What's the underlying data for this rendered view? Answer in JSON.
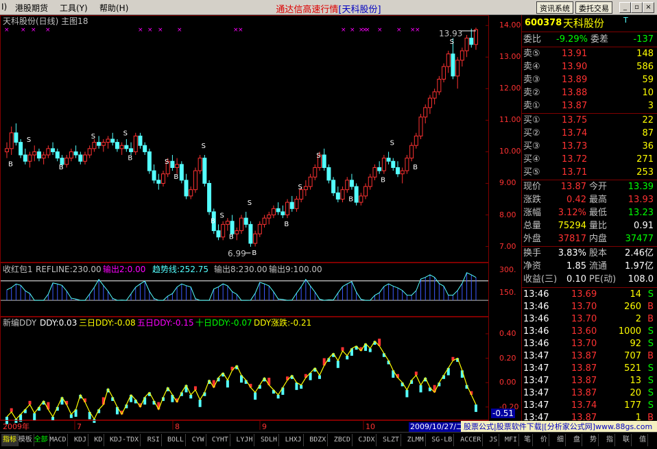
{
  "menu": {
    "items": [
      "I)",
      "港股期货",
      "工具(Y)",
      "帮助(H)"
    ],
    "title": "通达信高速行情",
    "title_stock": "[天科股份]",
    "btn_info": "资讯系统",
    "btn_trade": "委托交易"
  },
  "main_chart": {
    "title": "天科股份(日线) 主图18",
    "yticks": [
      "14.00",
      "13.00",
      "12.00",
      "11.00",
      "10.00",
      "9.00",
      "8.00",
      "7.00"
    ],
    "high_label": "13.93",
    "low_label": "6.99"
  },
  "ind1": {
    "label": "收红包1",
    "refline": "REFLINE:230.00",
    "out2": "输出2:0.00",
    "trend": "趋势线:252.75",
    "out8": "输出8:230.00",
    "out9": "输出9:100.00",
    "yticks": [
      "300.",
      "150."
    ]
  },
  "ind2": {
    "name": "新编DDY",
    "ddy": "DDY:0.03",
    "d3": "三日DDY:-0.08",
    "d5": "五日DDY:-0.15",
    "d10": "十日DDY:-0.07",
    "rise": "DDY涨跌:-0.21",
    "yticks": [
      "0.40",
      "0.20",
      "0.00",
      "-0.20"
    ],
    "cur": "-0.51"
  },
  "xaxis": {
    "labels": [
      "2009年",
      "7",
      "8",
      "9",
      "10"
    ],
    "date_box": "2009/10/27/二"
  },
  "colors": {
    "up": "#ff3232",
    "down": "#54ffff",
    "yellow": "#ffff00",
    "magenta": "#ff00ff",
    "green": "#00ff00",
    "white": "#ffffff",
    "frame": "#800000"
  },
  "panel": {
    "code": "600378",
    "name": "天科股份",
    "suffix": "T",
    "wb_label": "委比",
    "wb_val": "-9.29%",
    "wc_label": "委差",
    "wc_val": "-137",
    "sells": [
      {
        "label": "卖⑤",
        "price": "13.91",
        "vol": "148"
      },
      {
        "label": "卖④",
        "price": "13.90",
        "vol": "586"
      },
      {
        "label": "卖③",
        "price": "13.89",
        "vol": "59"
      },
      {
        "label": "卖②",
        "price": "13.88",
        "vol": "10"
      },
      {
        "label": "卖①",
        "price": "13.87",
        "vol": "3"
      }
    ],
    "buys": [
      {
        "label": "买①",
        "price": "13.75",
        "vol": "22"
      },
      {
        "label": "买②",
        "price": "13.74",
        "vol": "87"
      },
      {
        "label": "买③",
        "price": "13.73",
        "vol": "36"
      },
      {
        "label": "买④",
        "price": "13.72",
        "vol": "271"
      },
      {
        "label": "买⑤",
        "price": "13.71",
        "vol": "253"
      }
    ],
    "stats": [
      {
        "l1": "现价",
        "v1": "13.87",
        "l2": "今开",
        "v2": "13.39",
        "c1": "#ff3232",
        "c2": "#00ff00"
      },
      {
        "l1": "涨跌",
        "v1": "0.42",
        "l2": "最高",
        "v2": "13.93",
        "c1": "#ff3232",
        "c2": "#ff3232"
      },
      {
        "l1": "涨幅",
        "v1": "3.12%",
        "l2": "最低",
        "v2": "13.23",
        "c1": "#ff3232",
        "c2": "#00ff00"
      },
      {
        "l1": "总量",
        "v1": "75294",
        "l2": "量比",
        "v2": "0.91",
        "c1": "#ffff00",
        "c2": "#ffffff"
      },
      {
        "l1": "外盘",
        "v1": "37817",
        "l2": "内盘",
        "v2": "37477",
        "c1": "#ff3232",
        "c2": "#00ff00"
      }
    ],
    "fund": [
      {
        "l1": "换手",
        "v1": "3.83%",
        "l2": "股本",
        "v2": "2.46亿"
      },
      {
        "l1": "净资",
        "v1": "1.85",
        "l2": "流通",
        "v2": "1.97亿"
      },
      {
        "l1": "收益(三)",
        "v1": "0.10",
        "l2": "PE(动)",
        "v2": "108.0"
      }
    ],
    "ticks": [
      {
        "t": "13:46",
        "p": "13.69",
        "v": "14",
        "d": "S",
        "pc": "#ff3232",
        "dc": "#00ff00"
      },
      {
        "t": "13:46",
        "p": "13.70",
        "v": "260",
        "d": "B",
        "pc": "#ff3232",
        "dc": "#ff3232"
      },
      {
        "t": "13:46",
        "p": "13.70",
        "v": "2",
        "d": "B",
        "pc": "#ff3232",
        "dc": "#ff3232"
      },
      {
        "t": "13:46",
        "p": "13.60",
        "v": "1000",
        "d": "S",
        "pc": "#ff3232",
        "dc": "#00ff00"
      },
      {
        "t": "13:46",
        "p": "13.70",
        "v": "92",
        "d": "S",
        "pc": "#ff3232",
        "dc": "#00ff00"
      },
      {
        "t": "13:47",
        "p": "13.87",
        "v": "707",
        "d": "B",
        "pc": "#ff3232",
        "dc": "#ff3232"
      },
      {
        "t": "13:47",
        "p": "13.87",
        "v": "521",
        "d": "S",
        "pc": "#ff3232",
        "dc": "#00ff00"
      },
      {
        "t": "13:47",
        "p": "13.87",
        "v": "13",
        "d": "S",
        "pc": "#ff3232",
        "dc": "#00ff00"
      },
      {
        "t": "13:47",
        "p": "13.87",
        "v": "20",
        "d": "S",
        "pc": "#ff3232",
        "dc": "#00ff00"
      },
      {
        "t": "13:47",
        "p": "13.74",
        "v": "177",
        "d": "S",
        "pc": "#ff3232",
        "dc": "#00ff00"
      },
      {
        "t": "13:47",
        "p": "13.87",
        "v": "1",
        "d": "B",
        "pc": "#ff3232",
        "dc": "#ff3232"
      }
    ],
    "bottom_tabs": [
      "笔",
      "价",
      "细",
      "盘",
      "势",
      "指",
      "联",
      "值"
    ]
  },
  "tabs": [
    "指标",
    "模板",
    "全部",
    "MACD",
    "KDJ",
    "KD",
    "KDJ-TDX",
    "RSI",
    "BOLL",
    "CYW",
    "CYHT",
    "LYJH",
    "SDLH",
    "LHXJ",
    "BDZX",
    "ZBCD",
    "CJDX",
    "SLZT",
    "ZLMM",
    "SG-LB",
    "ACCER",
    "JS",
    "MFI"
  ],
  "ad_text": "股票公式|股票软件下载|[分析家公式网]www.88gs.com",
  "chart_data": {
    "type": "candlestick",
    "title": "天科股份(日线)",
    "x_axis_labels": [
      "2009年",
      "7",
      "8",
      "9",
      "10"
    ],
    "ylim": [
      6.6,
      14.2
    ],
    "high": 13.93,
    "low": 6.99,
    "ohlc": [
      [
        10.0,
        10.3,
        9.8,
        10.1
      ],
      [
        10.1,
        10.8,
        9.9,
        10.6
      ],
      [
        10.6,
        10.9,
        10.2,
        10.3
      ],
      [
        10.3,
        10.4,
        9.8,
        9.9
      ],
      [
        9.9,
        10.1,
        9.6,
        9.7
      ],
      [
        9.7,
        10.0,
        9.5,
        9.9
      ],
      [
        9.9,
        10.2,
        9.7,
        10.0
      ],
      [
        10.0,
        10.1,
        9.7,
        9.8
      ],
      [
        9.8,
        10.0,
        9.6,
        9.9
      ],
      [
        9.9,
        10.2,
        9.8,
        10.1
      ],
      [
        10.1,
        10.3,
        9.9,
        10.0
      ],
      [
        10.0,
        10.1,
        9.7,
        9.8
      ],
      [
        9.8,
        9.9,
        9.5,
        9.6
      ],
      [
        9.6,
        9.9,
        9.5,
        9.8
      ],
      [
        9.8,
        10.1,
        9.7,
        10.0
      ],
      [
        10.0,
        10.2,
        9.8,
        9.9
      ],
      [
        9.9,
        10.0,
        9.6,
        9.7
      ],
      [
        9.7,
        10.0,
        9.6,
        9.9
      ],
      [
        9.9,
        10.2,
        9.8,
        10.1
      ],
      [
        10.1,
        10.4,
        10.0,
        10.3
      ],
      [
        10.3,
        10.5,
        10.1,
        10.2
      ],
      [
        10.2,
        10.4,
        10.0,
        10.3
      ],
      [
        10.3,
        10.5,
        10.1,
        10.4
      ],
      [
        10.4,
        10.6,
        10.2,
        10.3
      ],
      [
        10.3,
        10.4,
        10.0,
        10.1
      ],
      [
        10.1,
        10.3,
        9.9,
        10.2
      ],
      [
        10.2,
        10.4,
        10.0,
        10.1
      ],
      [
        10.1,
        10.3,
        9.9,
        10.0
      ],
      [
        10.0,
        10.6,
        9.9,
        10.5
      ],
      [
        10.5,
        10.6,
        10.1,
        10.2
      ],
      [
        10.2,
        10.3,
        9.9,
        10.0
      ],
      [
        10.0,
        10.1,
        9.3,
        9.4
      ],
      [
        9.4,
        9.6,
        9.0,
        9.1
      ],
      [
        9.1,
        9.3,
        8.8,
        9.0
      ],
      [
        9.0,
        9.4,
        8.9,
        9.3
      ],
      [
        9.3,
        9.8,
        9.2,
        9.7
      ],
      [
        9.7,
        9.9,
        9.4,
        9.5
      ],
      [
        9.5,
        9.8,
        9.3,
        9.6
      ],
      [
        9.6,
        9.7,
        9.0,
        9.1
      ],
      [
        9.1,
        9.3,
        8.5,
        8.6
      ],
      [
        8.6,
        8.9,
        8.5,
        8.8
      ],
      [
        8.8,
        9.5,
        8.7,
        9.4
      ],
      [
        9.4,
        9.9,
        9.3,
        9.8
      ],
      [
        9.8,
        9.9,
        8.9,
        9.0
      ],
      [
        9.0,
        9.1,
        8.0,
        8.1
      ],
      [
        8.1,
        8.2,
        7.4,
        7.5
      ],
      [
        7.5,
        7.7,
        7.2,
        7.3
      ],
      [
        7.3,
        7.8,
        7.2,
        7.7
      ],
      [
        7.7,
        7.9,
        7.5,
        7.8
      ],
      [
        7.8,
        8.0,
        7.3,
        7.4
      ],
      [
        7.4,
        7.6,
        7.2,
        7.5
      ],
      [
        7.5,
        8.0,
        7.4,
        7.9
      ],
      [
        7.9,
        8.1,
        7.6,
        7.7
      ],
      [
        7.7,
        7.8,
        6.99,
        7.1
      ],
      [
        7.1,
        7.5,
        7.0,
        7.4
      ],
      [
        7.4,
        7.8,
        7.3,
        7.7
      ],
      [
        7.7,
        8.0,
        7.6,
        7.9
      ],
      [
        7.9,
        8.1,
        7.7,
        8.0
      ],
      [
        8.0,
        8.3,
        7.9,
        8.2
      ],
      [
        8.2,
        8.4,
        8.0,
        8.1
      ],
      [
        8.1,
        8.3,
        7.9,
        8.0
      ],
      [
        8.0,
        8.5,
        7.9,
        8.4
      ],
      [
        8.4,
        8.6,
        8.1,
        8.2
      ],
      [
        8.2,
        8.6,
        8.1,
        8.5
      ],
      [
        8.5,
        8.9,
        8.4,
        8.8
      ],
      [
        8.8,
        9.1,
        8.6,
        8.9
      ],
      [
        8.9,
        9.3,
        8.8,
        9.2
      ],
      [
        9.2,
        9.6,
        9.1,
        9.5
      ],
      [
        9.5,
        10.0,
        9.4,
        9.9
      ],
      [
        9.9,
        10.1,
        9.4,
        9.5
      ],
      [
        9.5,
        9.6,
        9.0,
        9.1
      ],
      [
        9.1,
        9.2,
        8.6,
        8.7
      ],
      [
        8.7,
        8.9,
        8.4,
        8.5
      ],
      [
        8.5,
        8.9,
        8.4,
        8.8
      ],
      [
        8.8,
        9.2,
        8.7,
        9.1
      ],
      [
        9.1,
        9.3,
        8.8,
        8.9
      ],
      [
        8.9,
        9.0,
        8.3,
        8.4
      ],
      [
        8.4,
        8.7,
        8.3,
        8.6
      ],
      [
        8.6,
        9.0,
        8.5,
        8.9
      ],
      [
        8.9,
        9.3,
        8.8,
        9.2
      ],
      [
        9.2,
        9.6,
        9.1,
        9.5
      ],
      [
        9.5,
        9.7,
        9.3,
        9.4
      ],
      [
        9.4,
        9.9,
        9.3,
        9.8
      ],
      [
        9.8,
        10.0,
        9.6,
        9.7
      ],
      [
        9.7,
        9.8,
        9.4,
        9.5
      ],
      [
        9.5,
        9.7,
        9.2,
        9.3
      ],
      [
        9.3,
        9.5,
        9.0,
        9.4
      ],
      [
        9.4,
        9.9,
        9.3,
        9.8
      ],
      [
        9.8,
        10.3,
        9.7,
        10.2
      ],
      [
        10.2,
        10.6,
        10.1,
        10.5
      ],
      [
        10.5,
        11.2,
        10.4,
        11.1
      ],
      [
        11.1,
        11.5,
        10.9,
        11.4
      ],
      [
        11.4,
        11.8,
        11.2,
        11.7
      ],
      [
        11.7,
        12.0,
        11.5,
        11.9
      ],
      [
        11.9,
        12.4,
        11.8,
        12.3
      ],
      [
        12.3,
        12.8,
        12.2,
        12.7
      ],
      [
        12.7,
        13.2,
        12.5,
        13.1
      ],
      [
        13.1,
        13.6,
        12.3,
        12.4
      ],
      [
        12.4,
        13.0,
        12.0,
        12.9
      ],
      [
        12.9,
        13.3,
        12.7,
        13.2
      ],
      [
        13.2,
        13.7,
        13.0,
        13.6
      ],
      [
        13.6,
        13.9,
        13.3,
        13.4
      ],
      [
        13.4,
        13.93,
        13.23,
        13.87
      ]
    ],
    "ddy": [
      -0.28,
      -0.24,
      -0.3,
      -0.26,
      -0.22,
      -0.18,
      -0.25,
      -0.2,
      -0.15,
      -0.22,
      -0.28,
      -0.2,
      -0.12,
      -0.18,
      -0.26,
      -0.22,
      -0.1,
      -0.16,
      -0.24,
      -0.3,
      -0.22,
      -0.18,
      -0.05,
      -0.12,
      -0.2,
      -0.26,
      -0.18,
      -0.1,
      -0.14,
      -0.2,
      -0.12,
      -0.08,
      -0.15,
      -0.22,
      -0.12,
      -0.04,
      -0.1,
      -0.16,
      -0.08,
      -0.02,
      -0.1,
      -0.06,
      -0.14,
      -0.08,
      0.02,
      -0.04,
      0.04,
      0.08,
      0.02,
      0.1,
      0.14,
      0.06,
      0.02,
      -0.04,
      -0.08,
      -0.02,
      0.04,
      -0.02,
      -0.06,
      -0.1,
      -0.04,
      0.02,
      0.06,
      0.0,
      -0.02,
      0.04,
      0.08,
      0.12,
      0.06,
      0.14,
      0.2,
      0.24,
      0.18,
      0.26,
      0.22,
      0.28,
      0.3,
      0.26,
      0.32,
      0.28,
      0.34,
      0.3,
      0.24,
      0.18,
      0.1,
      0.04,
      0.0,
      -0.06,
      0.02,
      0.06,
      -0.02,
      0.04,
      -0.04,
      -0.08,
      0.0,
      0.06,
      0.12,
      0.18,
      0.2,
      0.1,
      -0.02,
      -0.1,
      -0.18
    ]
  }
}
